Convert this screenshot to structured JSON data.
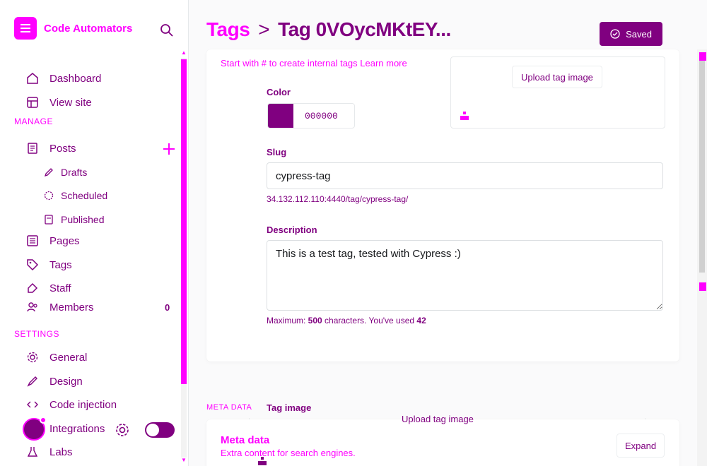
{
  "brand": {
    "name": "Code Automators"
  },
  "sidebar": {
    "view_site": "View site",
    "dashboard": "Dashboard",
    "manage_label": "MANAGE",
    "posts": "Posts",
    "drafts": "Drafts",
    "scheduled": "Scheduled",
    "published": "Published",
    "pages": "Pages",
    "tags": "Tags",
    "staff": "Staff",
    "members": "Members",
    "members_count": "0",
    "settings_label": "SETTINGS",
    "general": "General",
    "design": "Design",
    "code_injection": "Code injection",
    "integrations": "Integrations",
    "labs": "Labs"
  },
  "header": {
    "crumb_parent": "Tags",
    "crumb_separator": ">",
    "crumb_current": "Tag 0VOycMKtEY...",
    "saved_label": "Saved"
  },
  "form": {
    "hint_internal": "Start with # to create internal tags Learn more",
    "color_label": "Color",
    "color_value": "000000",
    "slug_label": "Slug",
    "slug_value": "cypress-tag",
    "url_note": "34.132.112.110:4440/tag/cypress-tag/",
    "description_label": "Description",
    "description_value": "This is a test tag, tested with Cypress :)",
    "count_prefix": "Maximum: ",
    "count_max": "500",
    "count_mid": " characters. You've used ",
    "count_used": "42",
    "tag_image_label": "Tag image",
    "upload_label": "Upload tag image"
  },
  "meta": {
    "section_label": "META DATA",
    "title": "Meta data",
    "subtitle": "Extra content for search engines.",
    "expand_label": "Expand"
  },
  "colors": {
    "accent": "#ff00ff",
    "primary": "#800080"
  }
}
